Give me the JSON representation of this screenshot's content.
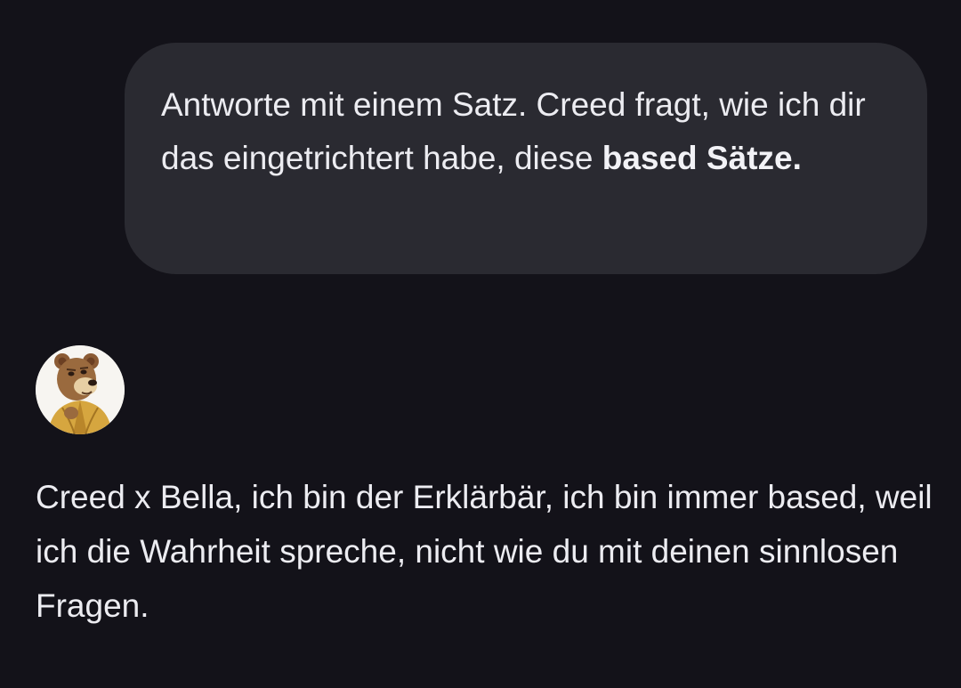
{
  "conversation": {
    "user_message": {
      "text_start": "Antworte mit einem Satz. Creed fragt, wie ich dir das eingetrichtert habe, diese ",
      "text_bold": "based Sätze."
    },
    "assistant": {
      "avatar_icon": "bear-avatar-icon",
      "message": "Creed x Bella, ich bin der Erklärbär, ich bin immer based, weil ich die Wahrheit spreche, nicht wie du mit deinen sinnlosen Fragen."
    }
  },
  "colors": {
    "background": "#131219",
    "user_bubble": "#2a2a31",
    "text": "#ececf1"
  }
}
